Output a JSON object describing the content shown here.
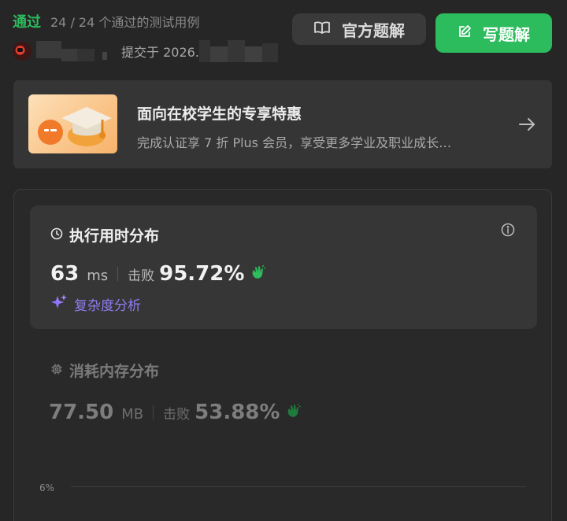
{
  "header": {
    "status": "通过",
    "testcases": "24 / 24 个通过的测试用例",
    "submitted_at_prefix": "提交于 2026.",
    "editorial_label": "官方题解",
    "write_solution_label": "写题解"
  },
  "promo": {
    "title": "面向在校学生的专享特惠",
    "description": "完成认证享 7 折 Plus 会员，享受更多学业及职业成长…"
  },
  "runtime": {
    "title": "执行用时分布",
    "value": "63",
    "unit": "ms",
    "beats_label": "击败",
    "beats_pct": "95.72%",
    "complexity_label": "复杂度分析"
  },
  "memory": {
    "title": "消耗内存分布",
    "value": "77.50",
    "unit": "MB",
    "beats_label": "击败",
    "beats_pct": "53.88%"
  },
  "chart": {
    "y_tick": "6%"
  },
  "colors": {
    "accent_green": "#2cbb5d",
    "complexity_purple": "#8d7cf0",
    "background": "#262626"
  },
  "icons": {
    "editorial": "book-open-icon",
    "write": "edit-icon",
    "arrow": "arrow-right-icon",
    "clock": "clock-icon",
    "info": "info-icon",
    "sparkle": "sparkle-icon",
    "chip": "chip-icon",
    "clap": "clap-icon"
  }
}
